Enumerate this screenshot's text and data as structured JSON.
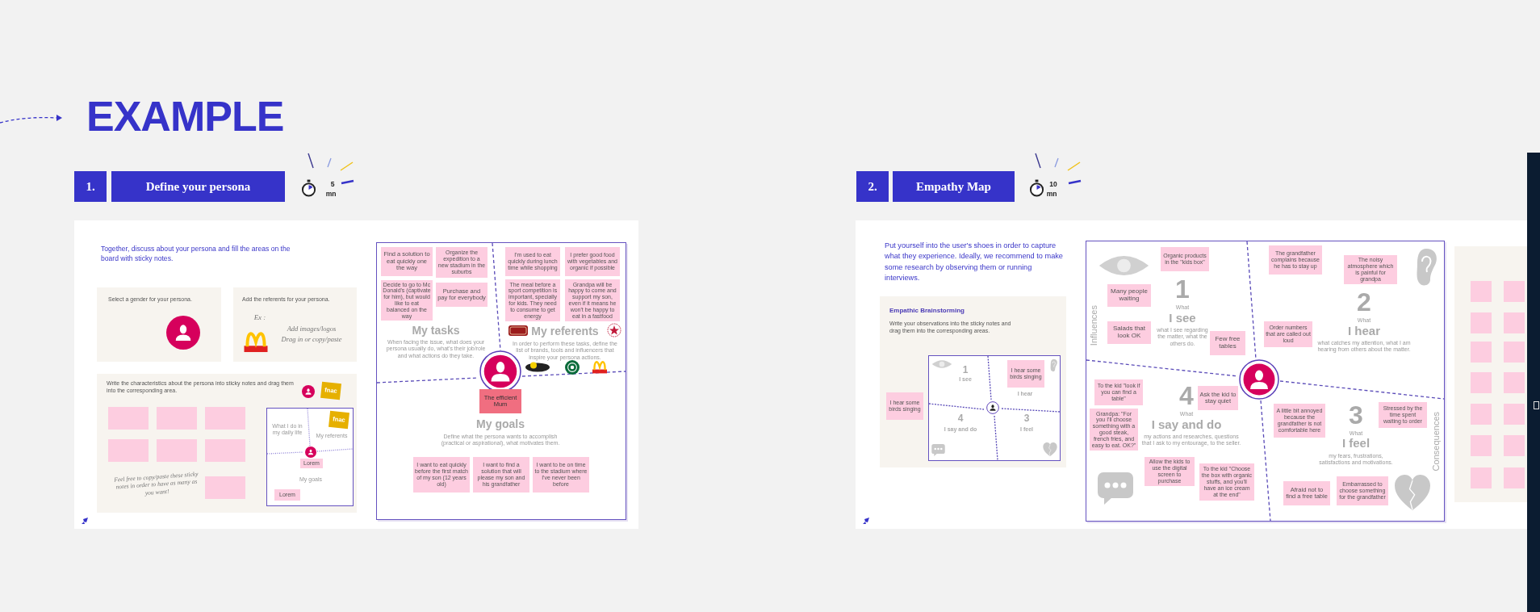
{
  "header": {
    "title": "EXAMPLE"
  },
  "steps": [
    {
      "number": "1.",
      "title": "Define your persona",
      "duration": "5",
      "unit": "mn"
    },
    {
      "number": "2.",
      "title": "Empathy Map",
      "duration": "10",
      "unit": "mn"
    }
  ],
  "persona": {
    "intro": "Together, discuss about your persona and fill the areas on the board with sticky notes.",
    "gender_panel": {
      "text": "Select a gender for your persona."
    },
    "referents_panel": {
      "text": "Add the referents for your persona.",
      "example": "Ex :",
      "hints": [
        "Add images/logos",
        "Drag in or copy/paste"
      ]
    },
    "characteristics_panel": {
      "text": "Write the characteristics about the persona into sticky notes and drag them into the corresponding area.",
      "logo": "fnac",
      "tip": "Feel free to copy/paste these sticky notes in order to have as many as you want!",
      "mini_board": {
        "labels": [
          "What I do in my daily life",
          "My referents",
          "My goals"
        ],
        "notes": [
          "Lorem",
          "Lorem"
        ],
        "logo": "fnac"
      }
    },
    "board": {
      "persona_name": "The efficient Mum",
      "quadrants": [
        {
          "title": "My tasks",
          "description": "When facing the issue, what does your persona usually do, what's their job/role and what actions do they take.",
          "notes": [
            "Find a solution to eat quickly one the way",
            "Organize the expedition to a new stadium in the suburbs",
            "Decide to go to Mc Donald's (captivate for him), but would like to eat balanced on the way",
            "Purchase and pay for everybody"
          ]
        },
        {
          "title": "My referents",
          "description": "In order to perform these tasks, define the list of brands, tools and influencers that inspire your persona actions.",
          "notes": [
            "I'm used to eat quickly during lunch time while shopping",
            "I prefer good food with vegetables and organic if possible",
            "The meal before a sport competition is important, specially for kids. They need to consume to get energy",
            "Grandpa will be happy to come and support my son, even if it means he won't be happy to eat in a fastfood"
          ]
        },
        {
          "title": "My goals",
          "description": "Define what the persona wants to accomplish (practical or aspirational), what motivates them.",
          "notes": [
            "I want to eat quickly before the first match of my son (12 years old)",
            "I want to find a solution that will please my son and his grandfather",
            "I want to be on time to the stadium where I've never been before"
          ]
        }
      ]
    }
  },
  "empathy": {
    "intro": "Put yourself into the user's shoes in order to capture what they experience. Ideally, we recommend to make some research by observing them or running  interviews.",
    "brainstorm": {
      "title": "Empathic Brainstorming",
      "text": "Write your observations into the sticky notes and drag them into the corresponding areas.",
      "note": "I hear some birds singing",
      "mini_map": {
        "note": "I hear some birds singing",
        "quadrants": [
          {
            "number": "1",
            "label": "I see"
          },
          {
            "label": "I hear"
          },
          {
            "number": "4",
            "label": "I say and do"
          },
          {
            "number": "3",
            "label": "I feel"
          }
        ]
      }
    },
    "map": {
      "axes": [
        "Influences",
        "Consequences"
      ],
      "quadrants": [
        {
          "number": "1",
          "what": "What",
          "title": "I see",
          "description": "what I see regarding the matter, what the others do.",
          "notes": [
            "Organic products in the \"kids box\"",
            "Many people waiting",
            "Salads that look OK",
            "Few free tables"
          ]
        },
        {
          "number": "2",
          "what": "What",
          "title": "I hear",
          "description": "what catches my attention, what I am hearing from others about the matter.",
          "notes": [
            "The grandfather complains because he has to stay up",
            "Order numbers that are called out loud",
            "The noisy atmosphere which is painful for grandpa"
          ]
        },
        {
          "number": "3",
          "what": "What",
          "title": "I feel",
          "description": "my fears, frustrations, satisfactions and motivations.",
          "notes": [
            "A little bit annoyed because the grandfather is not comfortable here",
            "Stressed by the time spent waiting to order",
            "Afraid not to find a free table",
            "Embarrassed to choose something for the grandfather"
          ]
        },
        {
          "number": "4",
          "what": "What",
          "title": "I say and do",
          "description": "my actions and researches, questions that I ask to my entourage, to the seller.",
          "notes": [
            "To the kid \"look if you can find a table\"",
            "Grandpa: \"For you I'll choose something with a good steak, french fries, and easy to eat. OK?\"",
            "Ask the kid to stay quiet",
            "Allow the kids to use the digital screen to purchase",
            "To the kid \"Choose the box with organic stuffs, and you'll have an ice cream at the end\""
          ]
        }
      ]
    }
  }
}
